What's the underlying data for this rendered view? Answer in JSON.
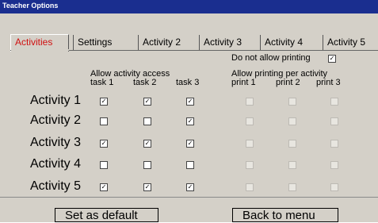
{
  "window": {
    "title": "Teacher Options"
  },
  "tabs": [
    "Activities",
    "Settings",
    "Activity 2",
    "Activity 3",
    "Activity 4",
    "Activity 5"
  ],
  "no_print": {
    "label": "Do not allow printing",
    "checked": true
  },
  "access": {
    "heading": "Allow activity access",
    "columns": [
      "task 1",
      "task 2",
      "task 3"
    ]
  },
  "printing": {
    "heading": "Allow printing per activity",
    "columns": [
      "print 1",
      "print 2",
      "print 3"
    ]
  },
  "rows": [
    {
      "label": "Activity 1",
      "tasks": [
        true,
        true,
        true
      ],
      "prints": [
        false,
        false,
        false
      ]
    },
    {
      "label": "Activity 2",
      "tasks": [
        false,
        false,
        true
      ],
      "prints": [
        false,
        false,
        false
      ]
    },
    {
      "label": "Activity 3",
      "tasks": [
        true,
        true,
        true
      ],
      "prints": [
        false,
        false,
        false
      ]
    },
    {
      "label": "Activity 4",
      "tasks": [
        false,
        false,
        false
      ],
      "prints": [
        false,
        false,
        false
      ]
    },
    {
      "label": "Activity 5",
      "tasks": [
        true,
        true,
        true
      ],
      "prints": [
        false,
        false,
        false
      ]
    }
  ],
  "buttons": {
    "default_label": "Set as default",
    "back_label": "Back to menu"
  },
  "colors": {
    "titlebar": "#1a2e8f",
    "active_tab_text": "#d01010",
    "dialog_bg": "#d4d0c8"
  }
}
